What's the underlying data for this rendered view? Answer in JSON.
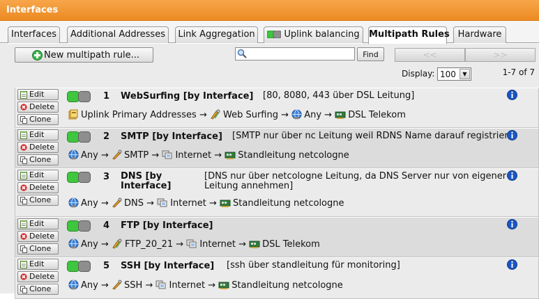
{
  "window": {
    "title": "Interfaces"
  },
  "tabs": [
    {
      "label": "Interfaces",
      "active": false,
      "lamp": false
    },
    {
      "label": "Additional Addresses",
      "active": false,
      "lamp": false
    },
    {
      "label": "Link Aggregation",
      "active": false,
      "lamp": false
    },
    {
      "label": "Uplink balancing",
      "active": false,
      "lamp": true
    },
    {
      "label": "Multipath Rules",
      "active": true,
      "lamp": false
    },
    {
      "label": "Hardware",
      "active": false,
      "lamp": false
    }
  ],
  "toolbar": {
    "new_rule_label": "New multipath rule...",
    "search_value": "",
    "search_placeholder": "",
    "find_label": "Find",
    "prev_label": "<<",
    "next_label": ">>",
    "display_label": "Display:",
    "display_value": "100",
    "count": "1-7 of 7"
  },
  "action_labels": {
    "edit": "Edit",
    "delete": "Delete",
    "clone": "Clone"
  },
  "arrow": "→",
  "colors": {
    "title_bar": "#ec8a22",
    "toggle_on": "#3ec63e",
    "info": "#1a55c2"
  },
  "rules": [
    {
      "number": "1",
      "name": "WebSurfing [by Interface]",
      "description": "[80, 8080, 443 über DSL Leitung]",
      "source": "Uplink Primary Addresses",
      "source_icon": "network-group-icon",
      "service": "Web Surfing",
      "service_icon": "service-group-icon",
      "destination": "Any",
      "destination_icon": "globe-icon",
      "interface": "DSL Telekom",
      "interface_icon": "interface-card-icon"
    },
    {
      "number": "2",
      "name": "SMTP [by Interface]",
      "description": "[SMTP nur über nc Leitung weil RDNS Name darauf registriert]",
      "source": "Any",
      "source_icon": "globe-icon",
      "service": "SMTP",
      "service_icon": "service-icon",
      "destination": "Internet",
      "destination_icon": "network-icon",
      "interface": "Standleitung netcologne",
      "interface_icon": "interface-card-icon"
    },
    {
      "number": "3",
      "name": "DNS [by Interface]",
      "description": "[DNS nur über netcologne Leitung, da DNS Server nur von eigener Leitung annehmen]",
      "source": "Any",
      "source_icon": "globe-icon",
      "service": "DNS",
      "service_icon": "service-icon",
      "destination": "Internet",
      "destination_icon": "network-icon",
      "interface": "Standleitung netcologne",
      "interface_icon": "interface-card-icon"
    },
    {
      "number": "4",
      "name": "FTP [by Interface]",
      "description": "",
      "source": "Any",
      "source_icon": "globe-icon",
      "service": "FTP_20_21",
      "service_icon": "service-group-icon",
      "destination": "Internet",
      "destination_icon": "network-icon",
      "interface": "DSL Telekom",
      "interface_icon": "interface-card-icon"
    },
    {
      "number": "5",
      "name": "SSH [by Interface]",
      "description": "[ssh über standleitung für monitoring]",
      "source": "Any",
      "source_icon": "globe-icon",
      "service": "SSH",
      "service_icon": "service-icon",
      "destination": "Internet",
      "destination_icon": "network-icon",
      "interface": "Standleitung netcologne",
      "interface_icon": "interface-card-icon"
    }
  ]
}
